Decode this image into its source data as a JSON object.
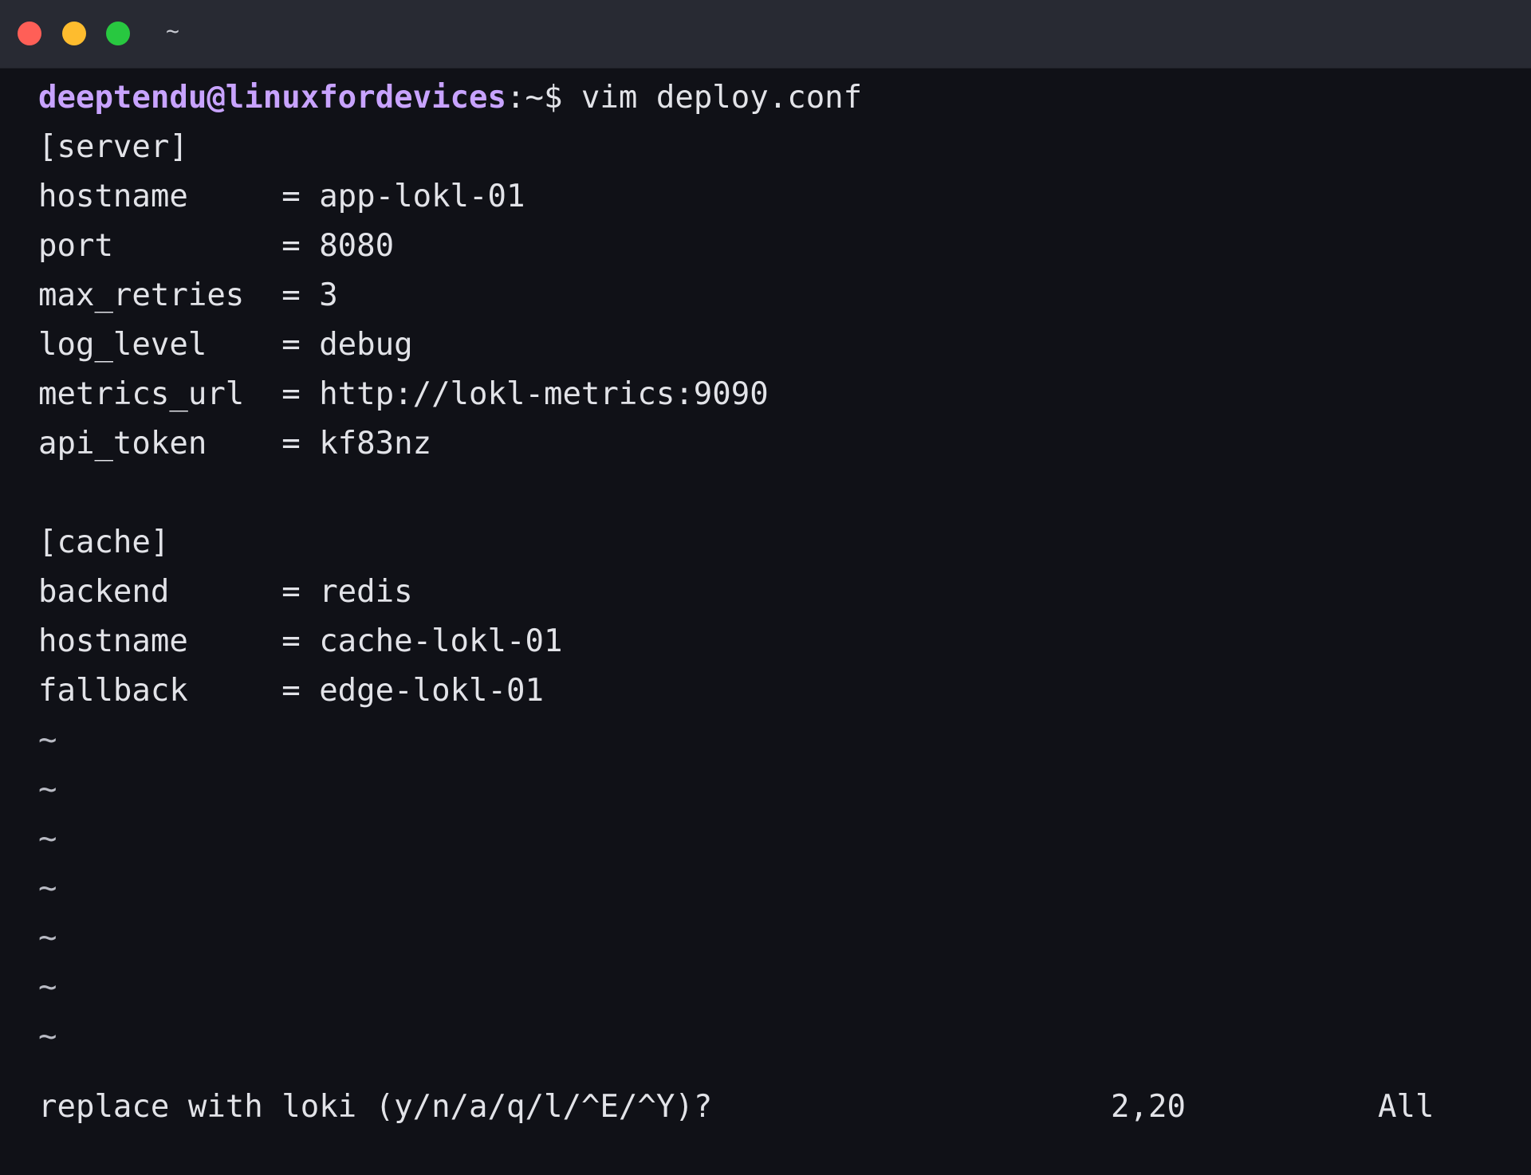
{
  "window": {
    "title": "~",
    "traffic_lights": {
      "close": "#ff5f57",
      "minimize": "#febc2e",
      "maximize": "#28c840"
    }
  },
  "prompt": {
    "user_host": "deeptendu@linuxfordevices",
    "path": ":~$",
    "command": " vim deploy.conf"
  },
  "buffer_lines": [
    "[server]",
    "hostname     = app-lokl-01",
    "port         = 8080",
    "max_retries  = 3",
    "log_level    = debug",
    "metrics_url  = http://lokl-metrics:9090",
    "api_token    = kf83nz",
    "",
    "[cache]",
    "backend      = redis",
    "hostname     = cache-lokl-01",
    "fallback     = edge-lokl-01"
  ],
  "empty_line_marker": "~",
  "empty_line_count": 7,
  "status": {
    "message": "replace with loki (y/n/a/q/l/^E/^Y)?",
    "position": "2,20",
    "scroll": "All"
  },
  "colors": {
    "background": "#101117",
    "titlebar": "#282a33",
    "prompt_user": "#c8a3ff",
    "text": "#e2e3e8"
  }
}
